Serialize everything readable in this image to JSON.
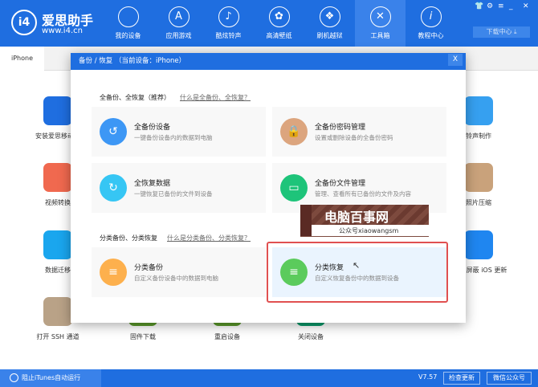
{
  "app": {
    "brand": "爱思助手",
    "url": "www.i4.cn",
    "logo": "i4"
  },
  "nav": [
    {
      "label": "我的设备",
      "icon": "apple-icon"
    },
    {
      "label": "应用游戏",
      "icon": "app-store-icon"
    },
    {
      "label": "酷炫铃声",
      "icon": "bell-icon"
    },
    {
      "label": "高清壁纸",
      "icon": "flower-icon"
    },
    {
      "label": "刷机越狱",
      "icon": "box-icon"
    },
    {
      "label": "工具箱",
      "icon": "tools-icon",
      "active": true
    },
    {
      "label": "教程中心",
      "icon": "info-icon"
    }
  ],
  "window_controls": [
    "shirt-icon",
    "gear-icon",
    "menu-icon",
    "minimize-icon",
    "close-icon"
  ],
  "download_center": "下载中心",
  "tab": "iPhone",
  "background_tools": {
    "left": [
      "安装爱思移动端",
      "视频转换",
      "数据迁移",
      "打开 SSH 通道"
    ],
    "bottom": [
      "固件下载",
      "重启设备",
      "关闭设备"
    ],
    "right": [
      "铃声制作",
      "照片压缩",
      "屏蔽 iOS 更新"
    ]
  },
  "dialog": {
    "title": "备份 / 恢复   （当前设备：iPhone）",
    "close": "X",
    "section1": {
      "title": "全备份、全恢复（推荐）",
      "link": "什么是全备份、全恢复？"
    },
    "section2": {
      "title": "分类备份、分类恢复",
      "link": "什么是分类备份、分类恢复？"
    },
    "cards": [
      {
        "title": "全备份设备",
        "desc": "一键备份设备内的数据到电脑",
        "color": "#3d97f5"
      },
      {
        "title": "全备份密码管理",
        "desc": "设置或删除设备的全备份密码",
        "color": "#dca57e"
      },
      {
        "title": "全恢复数据",
        "desc": "一键恢复已备份的文件到设备",
        "color": "#36c6f4"
      },
      {
        "title": "全备份文件管理",
        "desc": "管理、查看所有已备份的文件及内容",
        "color": "#1ec47a"
      },
      {
        "title": "分类备份",
        "desc": "自定义备份设备中的数据到电脑",
        "color": "#fdb04d"
      },
      {
        "title": "分类恢复",
        "desc": "自定义恢复备份中的数据到设备",
        "color": "#5bcb5c",
        "highlighted": true
      }
    ]
  },
  "watermark": {
    "title": "电脑百事网",
    "sub": "公众号xiaowangsm"
  },
  "footer": {
    "itunes": "阻止iTunes自动运行",
    "version": "V7.57",
    "check_update": "检查更新",
    "wechat": "微信公众号"
  }
}
